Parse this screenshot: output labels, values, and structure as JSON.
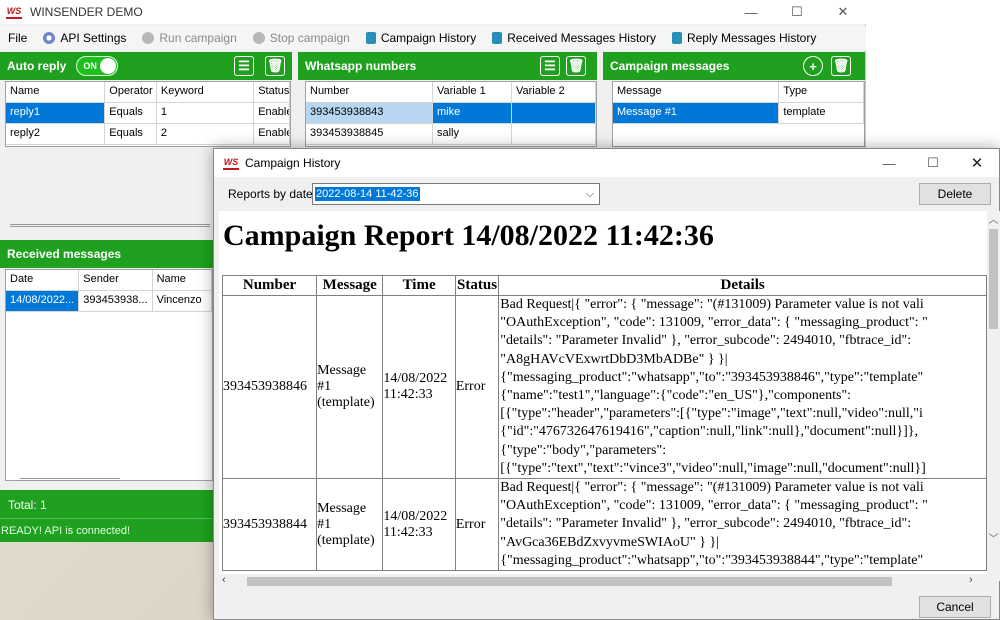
{
  "main_window": {
    "title": "WINSENDER DEMO",
    "controls": {
      "minimize": "—",
      "maximize": "☐",
      "close": "✕"
    }
  },
  "menu": [
    {
      "label": "File",
      "enabled": true
    },
    {
      "label": "API Settings",
      "enabled": true,
      "icon": "gear-icon"
    },
    {
      "label": "Run campaign",
      "enabled": false,
      "icon": "play-icon"
    },
    {
      "label": "Stop campaign",
      "enabled": false,
      "icon": "stop-icon"
    },
    {
      "label": "Campaign History",
      "enabled": true,
      "icon": "clipboard-icon"
    },
    {
      "label": "Received Messages History",
      "enabled": true,
      "icon": "clipboard-icon"
    },
    {
      "label": "Reply Messages History",
      "enabled": true,
      "icon": "clipboard-icon"
    }
  ],
  "auto_reply": {
    "title": "Auto reply",
    "toggle_label": "ON",
    "toggle_state": "on",
    "columns": [
      "Name",
      "Operator",
      "Keyword",
      "Status"
    ],
    "rows": [
      [
        "reply1",
        "Equals",
        "1",
        "Enable"
      ],
      [
        "reply2",
        "Equals",
        "2",
        "Enable"
      ]
    ]
  },
  "whatsapp_numbers": {
    "title": "Whatsapp numbers",
    "columns": [
      "Number",
      "Variable 1",
      "Variable 2"
    ],
    "rows": [
      [
        "393453938843",
        "mike",
        ""
      ],
      [
        "393453938845",
        "sally",
        ""
      ]
    ]
  },
  "campaign_messages": {
    "title": "Campaign messages",
    "columns": [
      "Message",
      "Type"
    ],
    "rows": [
      [
        "Message #1",
        "template"
      ]
    ]
  },
  "received_messages": {
    "title": "Received messages",
    "columns": [
      "Date",
      "Sender",
      "Name"
    ],
    "rows": [
      [
        "14/08/2022...",
        "393453938...",
        "Vincenzo"
      ]
    ]
  },
  "footer": {
    "total": "Total: 1",
    "status": "READY! API is connected!"
  },
  "dialog": {
    "title": "Campaign History",
    "reports_label": "Reports by date",
    "selected_report": "2022-08-14 11-42-36",
    "delete_label": "Delete",
    "cancel_label": "Cancel",
    "controls": {
      "minimize": "—",
      "maximize": "☐",
      "close": "✕"
    },
    "report_title": "Campaign Report 14/08/2022 11:42:36",
    "columns": [
      "Number",
      "Message",
      "Time",
      "Status",
      "Details"
    ],
    "rows": [
      {
        "number": "393453938846",
        "message": [
          "Message",
          "#1",
          "(template)"
        ],
        "time": [
          "14/08/2022",
          "11:42:33"
        ],
        "status": "Error",
        "details": [
          "Bad Request|{ \"error\": { \"message\": \"(#131009) Parameter value is not vali",
          "\"OAuthException\", \"code\": 131009, \"error_data\": { \"messaging_product\": \"",
          "\"details\": \"Parameter Invalid\" }, \"error_subcode\": 2494010, \"fbtrace_id\":",
          "\"A8gHAVcVExwrtDbD3MbADBe\" } }|",
          "{\"messaging_product\":\"whatsapp\",\"to\":\"393453938846\",\"type\":\"template\"",
          "{\"name\":\"test1\",\"language\":{\"code\":\"en_US\"},\"components\":",
          "[{\"type\":\"header\",\"parameters\":[{\"type\":\"image\",\"text\":null,\"video\":null,\"i",
          "{\"id\":\"476732647619416\",\"caption\":null,\"link\":null},\"document\":null}]},",
          "{\"type\":\"body\",\"parameters\":",
          "[{\"type\":\"text\",\"text\":\"vince3\",\"video\":null,\"image\":null,\"document\":null}]"
        ]
      },
      {
        "number": "393453938844",
        "message": [
          "Message",
          "#1",
          "(template)"
        ],
        "time": [
          "14/08/2022",
          "11:42:33"
        ],
        "status": "Error",
        "details": [
          "Bad Request|{ \"error\": { \"message\": \"(#131009) Parameter value is not vali",
          "\"OAuthException\", \"code\": 131009, \"error_data\": { \"messaging_product\": \"",
          "\"details\": \"Parameter Invalid\" }, \"error_subcode\": 2494010, \"fbtrace_id\":",
          "\"AvGca36EBdZxvyvmeSWIAoU\" } }|",
          "{\"messaging_product\":\"whatsapp\",\"to\":\"393453938844\",\"type\":\"template\""
        ]
      }
    ]
  },
  "colors": {
    "panel_header": "#1fa11f",
    "selection": "#0078d7",
    "toggle_on": "#1ec01e",
    "logo_red": "#c0181e"
  }
}
